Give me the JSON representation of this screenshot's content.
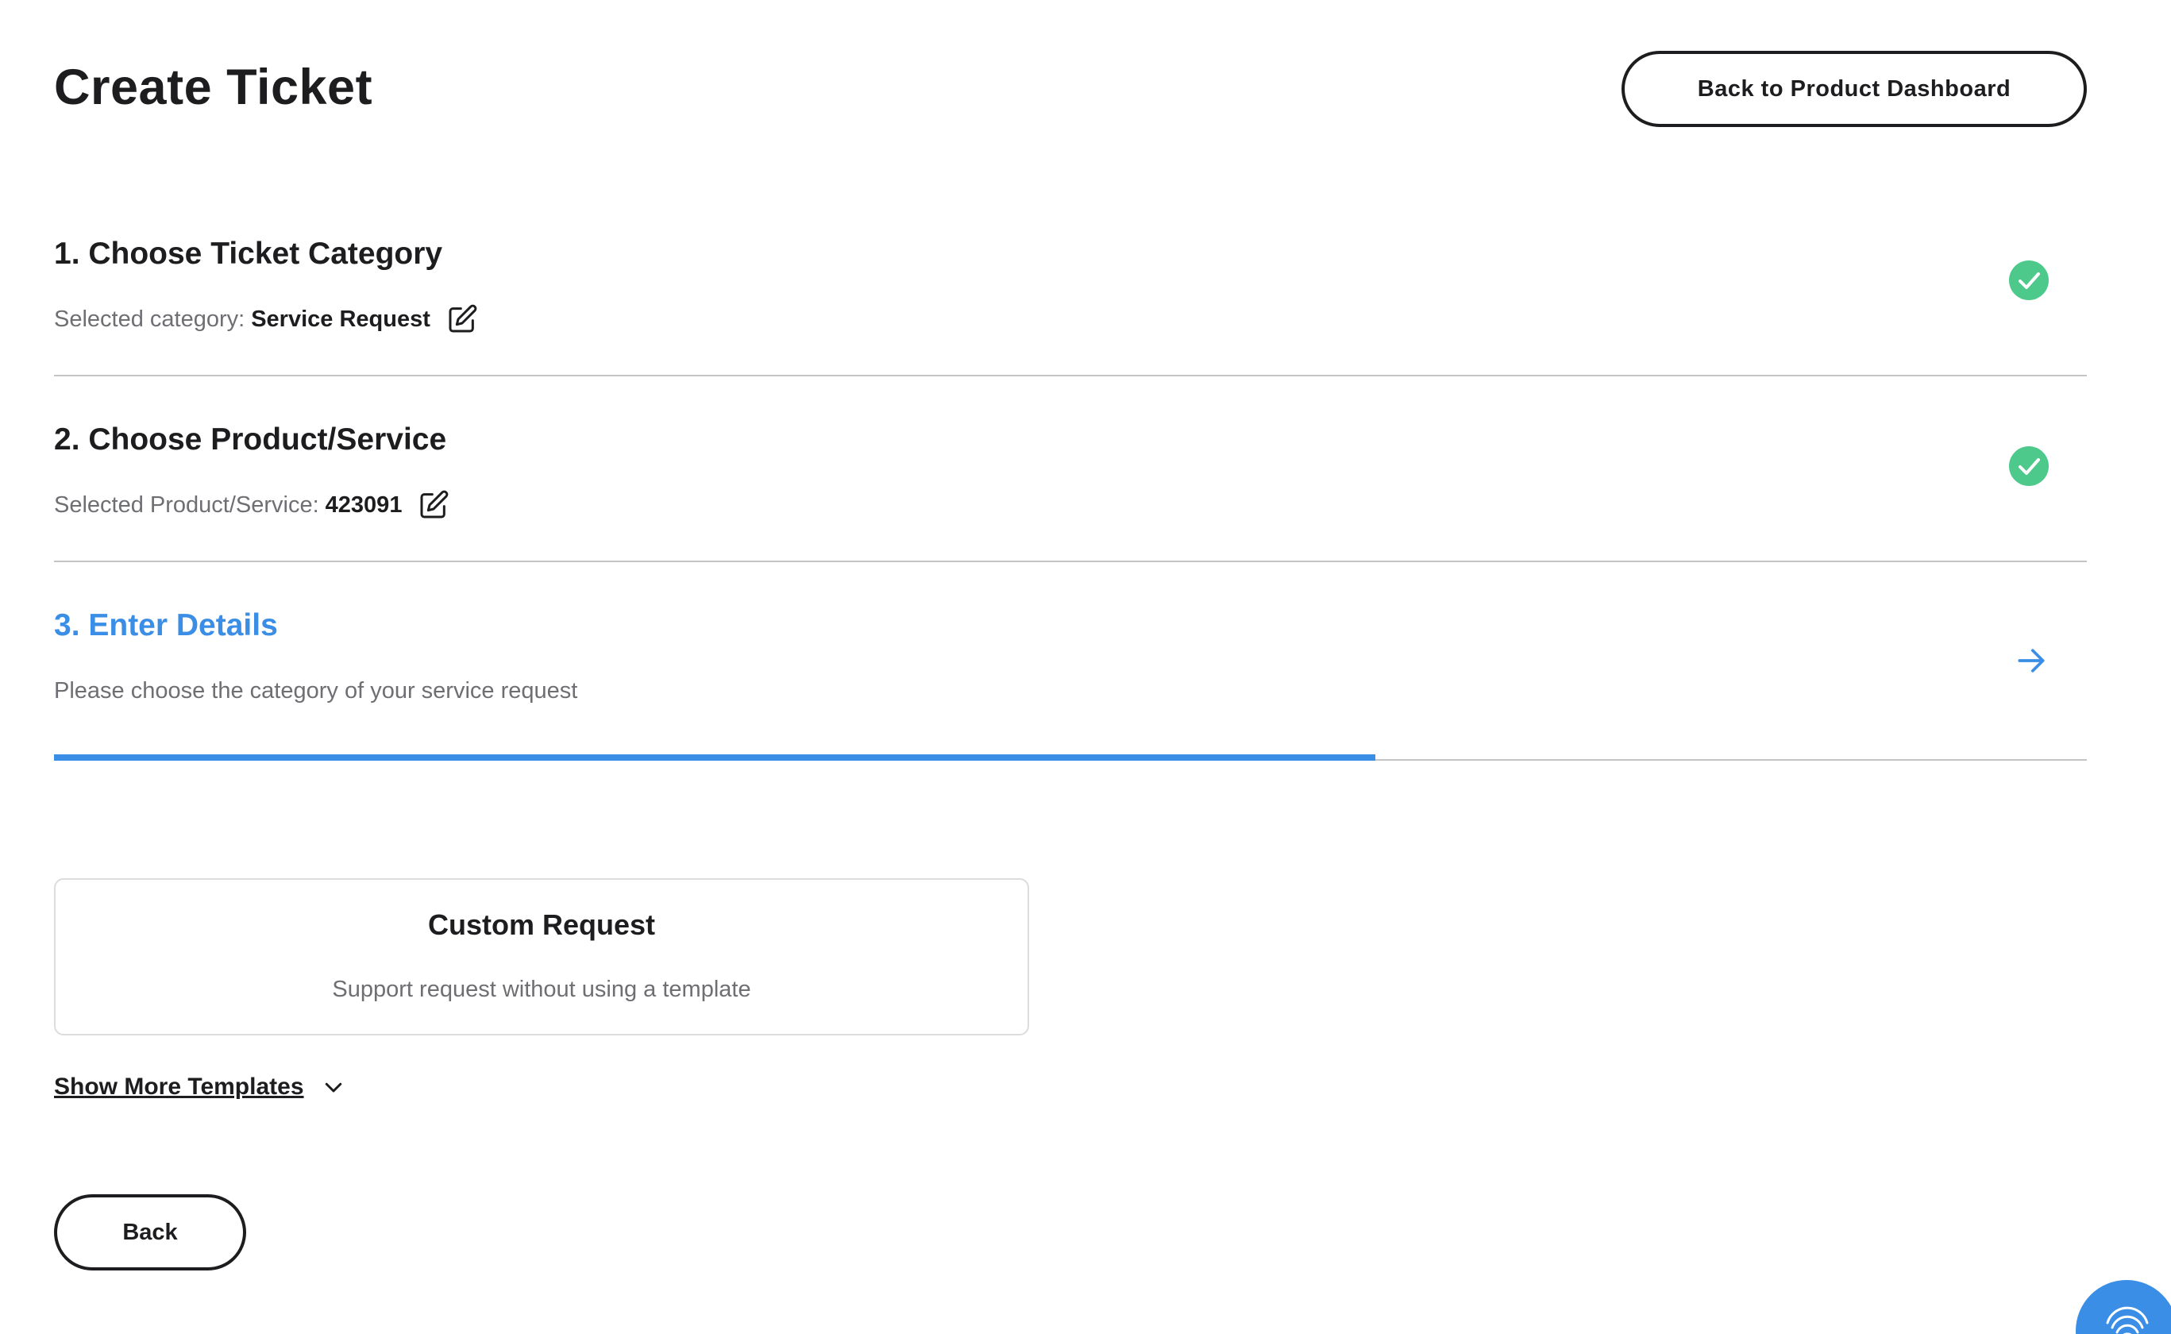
{
  "header": {
    "title": "Create Ticket",
    "back_dashboard_label": "Back to Product Dashboard"
  },
  "steps": [
    {
      "title": "1. Choose Ticket Category",
      "subtitle_label": "Selected category:",
      "subtitle_value": "Service Request",
      "status": "complete",
      "status_icon": "check-circle-icon"
    },
    {
      "title": "2. Choose Product/Service",
      "subtitle_label": "Selected Product/Service:",
      "subtitle_value": "423091",
      "status": "complete",
      "status_icon": "check-circle-icon"
    },
    {
      "title": "3. Enter Details",
      "subtitle_label": "Please choose the category of your service request",
      "status": "active",
      "status_icon": "arrow-right-icon",
      "progress_fraction": 0.65
    }
  ],
  "templates": [
    {
      "title": "Custom Request",
      "description": "Support request without using a template"
    }
  ],
  "show_more_label": "Show More Templates",
  "back_label": "Back",
  "colors": {
    "accent": "#3a8ee6",
    "success": "#4cc98b",
    "text": "#1d1d1f",
    "muted": "#6e6e73",
    "divider": "#c4c4c4"
  },
  "icons": {
    "edit": "edit-icon",
    "chevron": "chevron-down-icon",
    "fab": "fingerprint-icon"
  }
}
